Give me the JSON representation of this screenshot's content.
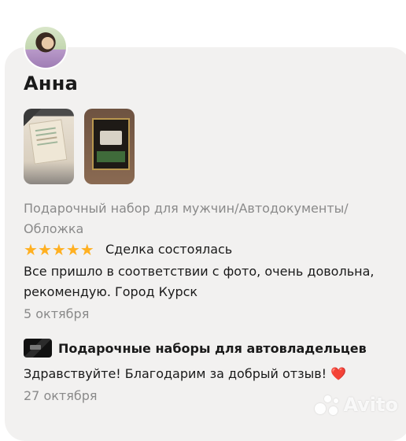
{
  "review": {
    "author_name": "Анна",
    "category": "Подарочный набор для мужчин/Автодокументы/ Обложка",
    "rating": 5,
    "deal_status": "Сделка состоялась",
    "text": "Все пришло в соответствии с фото, очень довольна, рекомендую. Город Курск",
    "date": "5 октября"
  },
  "reply": {
    "seller_name": "Подарочные наборы для автовладельцев",
    "text": "Здравствуйте! Благодарим за добрый отзыв!",
    "emoji": "❤️",
    "date": "27 октября"
  },
  "watermark": "Avito",
  "colors": {
    "card_bg": "#f2f1f0",
    "star": "#ffb021",
    "muted_text": "#8a8a8a",
    "heart": "#e3242b"
  },
  "icons": {
    "stars": [
      "star-icon",
      "star-icon",
      "star-icon",
      "star-icon",
      "star-icon"
    ]
  }
}
